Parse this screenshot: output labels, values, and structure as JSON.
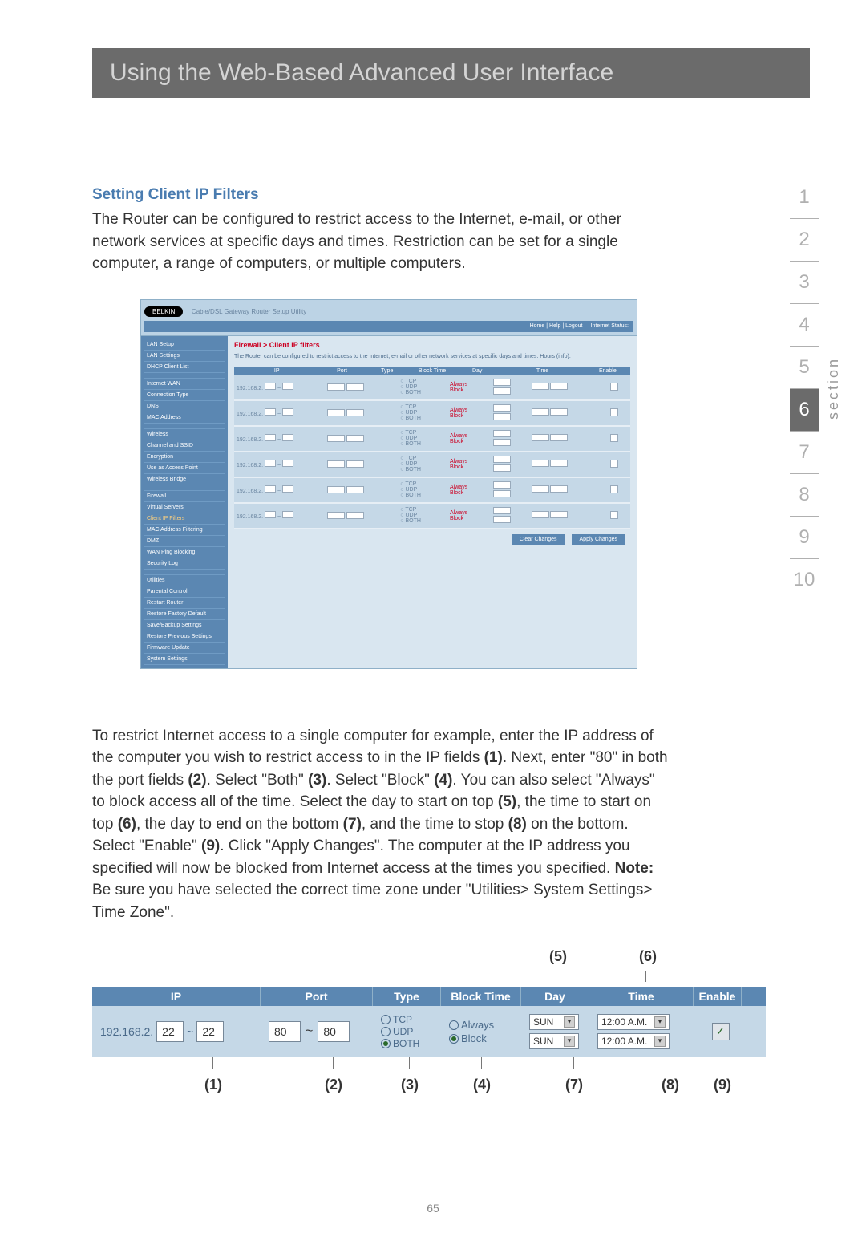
{
  "header": {
    "title": "Using the Web-Based Advanced User Interface"
  },
  "section_heading": "Setting Client IP Filters",
  "intro": "The Router can be configured to restrict access to the Internet, e-mail, or other network services at specific days and times. Restriction can be set for a single computer, a range of computers, or multiple computers.",
  "screenshot": {
    "brand": "BELKIN",
    "crumbs": "Cable/DSL Gateway Router Setup Utility",
    "topbar": {
      "home": "Home | Help | Logout",
      "status": "Internet Status:"
    },
    "nav": [
      "LAN Setup",
      "LAN Settings",
      "DHCP Client List",
      "",
      "Internet WAN",
      "Connection Type",
      "DNS",
      "MAC Address",
      "",
      "Wireless",
      "Channel and SSID",
      "Encryption",
      "Use as Access Point",
      "Wireless Bridge",
      "",
      "Firewall",
      "Virtual Servers",
      "Client IP Filters",
      "MAC Address Filtering",
      "DMZ",
      "WAN Ping Blocking",
      "Security Log",
      "",
      "Utilities",
      "Parental Control",
      "Restart Router",
      "Restore Factory Default",
      "Save/Backup Settings",
      "Restore Previous Settings",
      "Firmware Update",
      "System Settings"
    ],
    "content_title": "Firewall > Client IP filters",
    "content_desc": "The Router can be configured to restrict access to the Internet, e-mail or other network services at specific days and times. Hours (info).",
    "table_head": [
      "IP",
      "Port",
      "Type",
      "Block Time",
      "Day",
      "Time",
      "Enable"
    ],
    "row": {
      "ip_prefix": "192.168.2.",
      "types": [
        "TCP",
        "UDP",
        "BOTH"
      ],
      "bt": [
        "Always",
        "Block"
      ]
    },
    "buttons": {
      "clear": "Clear Changes",
      "apply": "Apply Changes"
    }
  },
  "body_text_parts": {
    "p1": "To restrict Internet access to a single computer for example, enter the IP address of the computer you wish to restrict access to in the IP fields ",
    "b1": "(1)",
    "p2": ". Next, enter \"80\" in both the port fields ",
    "b2": "(2)",
    "p3": ". Select \"Both\" ",
    "b3": "(3)",
    "p4": ". Select \"Block\" ",
    "b4": "(4)",
    "p5": ". You can also select \"Always\" to block access all of the time. Select the day to start on top ",
    "b5": "(5)",
    "p6": ", the time to start on top ",
    "b6": "(6)",
    "p7": ", the day to end on the bottom ",
    "b7": "(7)",
    "p8": ", and the time to stop ",
    "b8": "(8)",
    "p9": " on the bottom. Select \"Enable\" ",
    "b9": "(9)",
    "p10": ". Click \"Apply Changes\". The computer at the IP address you specified will now be blocked from Internet access at the times you specified. ",
    "note": "Note:",
    "p11": " Be sure you have selected the correct time zone under \"Utilities> System Settings> Time Zone\"."
  },
  "figure2": {
    "top_callouts": {
      "c5": "(5)",
      "c6": "(6)"
    },
    "head": [
      "IP",
      "Port",
      "Type",
      "Block Time",
      "Day",
      "Time",
      "Enable"
    ],
    "row": {
      "ip_prefix": "192.168.2.",
      "ip_from": "22",
      "ip_to": "22",
      "port_from": "80",
      "port_to": "80",
      "types": {
        "tcp": "TCP",
        "udp": "UDP",
        "both": "BOTH"
      },
      "bt": {
        "always": "Always",
        "block": "Block"
      },
      "day1": "SUN",
      "day2": "SUN",
      "time1": "12:00 A.M.",
      "time2": "12:00 A.M.",
      "enable": "✓"
    },
    "bottom_callouts": {
      "c1": "(1)",
      "c2": "(2)",
      "c3": "(3)",
      "c4": "(4)",
      "c7": "(7)",
      "c8": "(8)",
      "c9": "(9)"
    }
  },
  "side_nav": {
    "items": [
      "1",
      "2",
      "3",
      "4",
      "5",
      "6",
      "7",
      "8",
      "9",
      "10"
    ],
    "current": "6",
    "word": "section"
  },
  "page_number": "65"
}
